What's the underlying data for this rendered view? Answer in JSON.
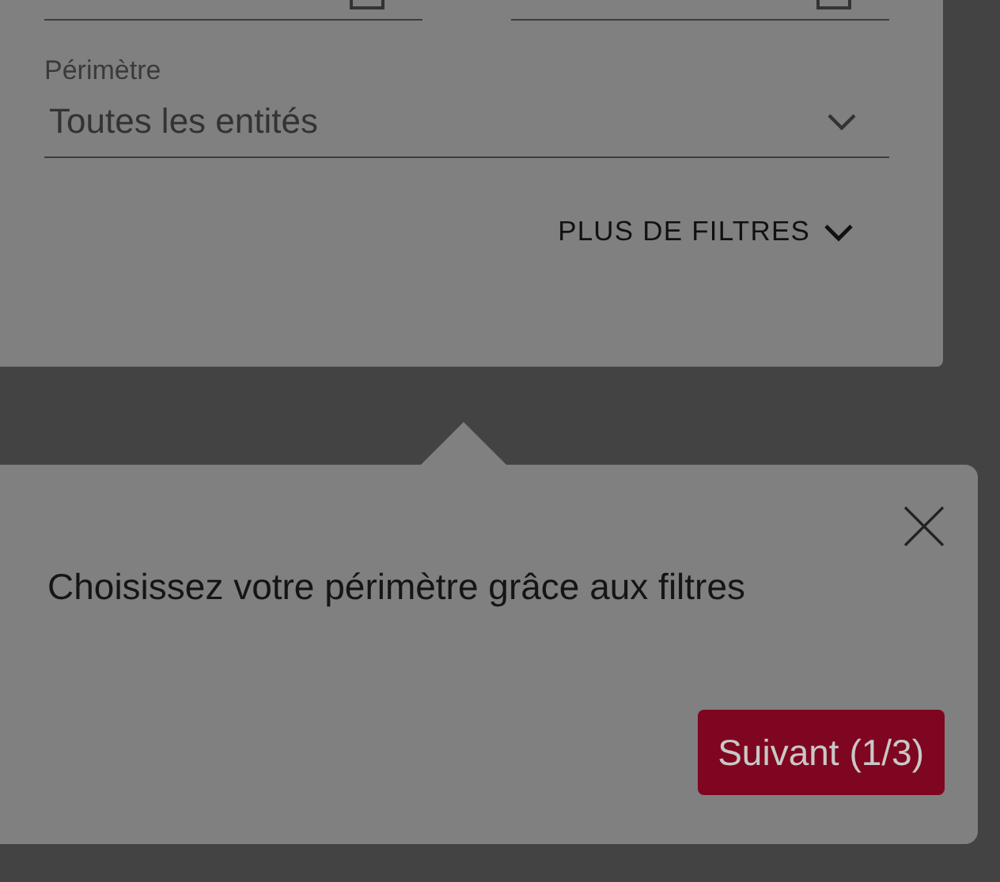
{
  "filters": {
    "perimeter": {
      "label": "Périmètre",
      "value": "Toutes les entités"
    },
    "more_filters": {
      "label": "PLUS DE FILTRES"
    }
  },
  "tour_popover": {
    "message": "Choisissez votre périmètre grâce aux filtres",
    "next_button": "Suivant (1/3)"
  }
}
